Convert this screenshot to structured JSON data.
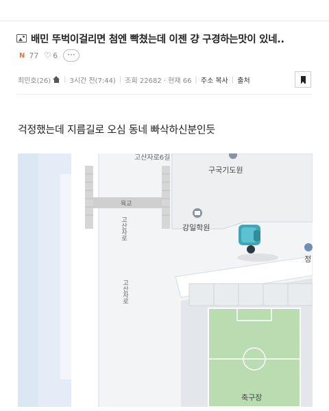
{
  "post": {
    "title": "배민 뚜벅이걸리면 첨엔 빡쳤는데 이젠 걍 구경하는맛이 있네..",
    "new_badge": "N",
    "comments": "77",
    "likes": "6",
    "more": "···",
    "author": "최민호(26)",
    "time": "3시간 전(7:44)",
    "views": "조회 22682 · 현재 66",
    "copy_url": "주소 복사",
    "source": "출처",
    "body": "걱정했는데 지름길로 오심 동네 빠삭하신분인듯"
  },
  "map": {
    "road_top": "고산자로6길",
    "bridge": "육교",
    "road_left": "고산자로",
    "road_center": "고산자로",
    "poi_1": "구국기도원",
    "poi_2": "강일학원",
    "poi_3": "정",
    "poi_4": "축구장"
  }
}
